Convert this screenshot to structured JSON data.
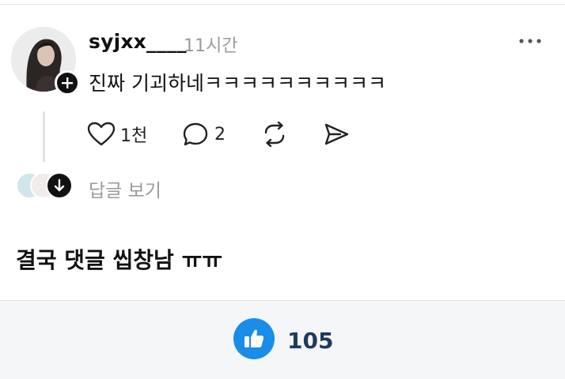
{
  "post": {
    "username": "syjxx____",
    "timestamp": "11시간",
    "comment": "진짜 기괴하네ㅋㅋㅋㅋㅋㅋㅋㅋㅋㅋ",
    "actions": {
      "like_count": "1천",
      "reply_count": "2"
    },
    "view_replies_label": "답글 보기"
  },
  "caption": "결국 댓글 씹창남 ㅠㅠ",
  "footer": {
    "like_count": "105"
  },
  "colors": {
    "like_blue": "#1a8de9",
    "like_count_text": "#1d3b61",
    "muted_gray": "#9a9a9a"
  },
  "icons": [
    "plus-icon",
    "more-icon",
    "heart-icon",
    "comment-icon",
    "repost-icon",
    "send-icon",
    "arrow-down-icon",
    "thumbs-up-icon"
  ]
}
